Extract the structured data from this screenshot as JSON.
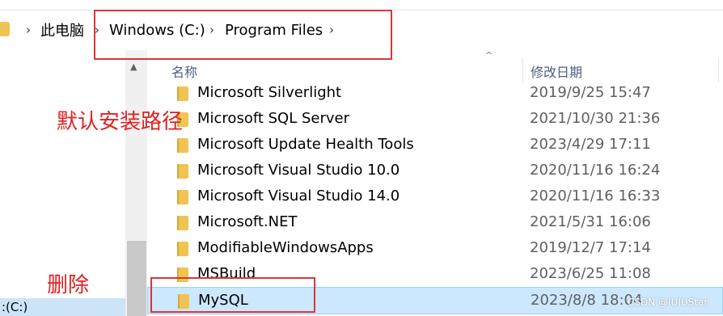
{
  "breadcrumb": {
    "items": [
      "此电脑",
      "Windows (C:)",
      "Program Files"
    ]
  },
  "columns": {
    "name": "名称",
    "date_modified": "修改日期"
  },
  "files": [
    {
      "name": "Microsoft Silverlight",
      "date": "2019/9/25 15:47"
    },
    {
      "name": "Microsoft SQL Server",
      "date": "2021/10/30 21:36"
    },
    {
      "name": "Microsoft Update Health Tools",
      "date": "2023/4/29 17:11"
    },
    {
      "name": "Microsoft Visual Studio 10.0",
      "date": "2020/11/16 16:24"
    },
    {
      "name": "Microsoft Visual Studio 14.0",
      "date": "2020/11/16 16:33"
    },
    {
      "name": "Microsoft.NET",
      "date": "2021/5/31 16:06"
    },
    {
      "name": "ModifiableWindowsApps",
      "date": "2019/12/7 17:14"
    },
    {
      "name": "MSBuild",
      "date": "2023/6/25 11:08"
    },
    {
      "name": "MySQL",
      "date": "2023/8/8 18:04",
      "selected": true
    }
  ],
  "nav": {
    "drive_label": ":(C:)"
  },
  "annotations": {
    "default_path": "默认安装路径",
    "delete": "删除"
  },
  "watermark": "CSDN @IUIUStar",
  "colors": {
    "annotation_red": "#d93737",
    "selection": "#cce8ff",
    "folder": "#f0c452"
  },
  "icons": {
    "folder": "folder-icon",
    "chevron": "chevron-right-icon",
    "sort": "sort-up-icon"
  }
}
